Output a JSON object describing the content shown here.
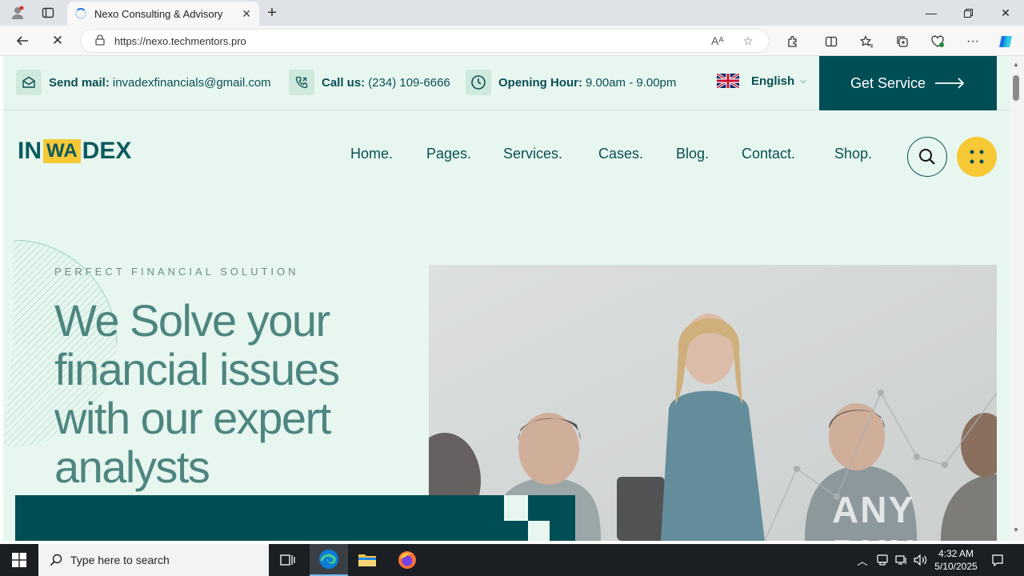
{
  "browser": {
    "tab_title": "Nexo Consulting & Advisory",
    "url": "https://nexo.techmentors.pro",
    "read_aloud": "Aᴬ"
  },
  "topbar": {
    "mail_label": "Send mail:",
    "mail_value": "invadexfinancials@gmail.com",
    "call_label": "Call us:",
    "call_value": "(234) 109-6666",
    "hours_label": "Opening Hour:",
    "hours_value": "9.00am - 9.00pm",
    "language": "English",
    "cta": "Get Service"
  },
  "logo": {
    "left": "IN",
    "mid": "WA",
    "right": "DEX"
  },
  "menu": [
    "Home.",
    "Pages.",
    "Services.",
    "Cases.",
    "Blog.",
    "Contact.",
    "Shop."
  ],
  "hero": {
    "subtitle": "PERFECT FINANCIAL SOLUTION",
    "title": "We Solve your financial issues with our expert analysts"
  },
  "watermark": "ANY RUN",
  "taskbar": {
    "search_placeholder": "Type here to search",
    "time": "4:32 AM",
    "date": "5/10/2025"
  },
  "colors": {
    "brand_dark": "#004e55",
    "brand_yellow": "#f7c936",
    "page_bg": "#e7f7ef"
  }
}
